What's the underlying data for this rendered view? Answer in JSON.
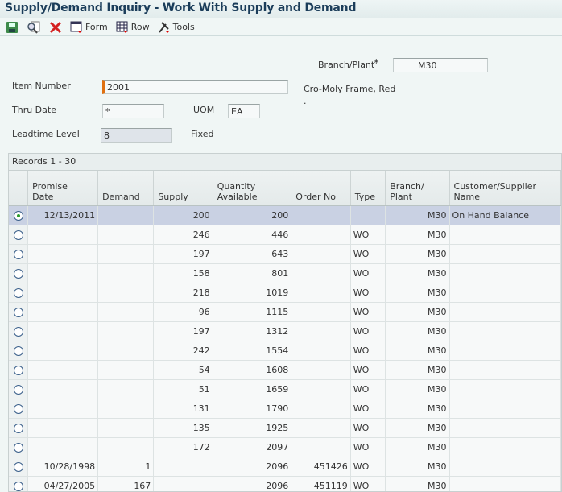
{
  "title": "Supply/Demand Inquiry - Work With Supply and Demand",
  "toolbar": {
    "save_icon": "floppy-disk-icon",
    "find_icon": "magnifier-icon",
    "close_icon": "red-x-icon",
    "form_label": "Form",
    "row_label": "Row",
    "tools_label": "Tools"
  },
  "form": {
    "branch_plant_label": "Branch/Plant",
    "required_mark": "*",
    "branch_plant_value": "M30",
    "item_number_label": "Item Number",
    "item_number_value": "2001",
    "item_description": "Cro-Moly Frame, Red",
    "item_description2": ".",
    "thru_date_label": "Thru Date",
    "thru_date_value": "*",
    "uom_label": "UOM",
    "uom_value": "EA",
    "leadtime_level_label": "Leadtime Level",
    "leadtime_level_value": "8",
    "leadtime_type": "Fixed"
  },
  "grid": {
    "records_label": "Records 1 - 30",
    "columns": [
      {
        "l1": "Promise",
        "l2": "Date"
      },
      {
        "l1": "",
        "l2": "Demand"
      },
      {
        "l1": "",
        "l2": "Supply"
      },
      {
        "l1": "Quantity",
        "l2": "Available"
      },
      {
        "l1": "",
        "l2": "Order No"
      },
      {
        "l1": "",
        "l2": "Type"
      },
      {
        "l1": "Branch/",
        "l2": "Plant"
      },
      {
        "l1": "",
        "l2": "Customer/Supplier Name"
      }
    ],
    "rows": [
      [
        "12/13/2011",
        "",
        "200",
        "200",
        "",
        "",
        "M30",
        "On Hand Balance"
      ],
      [
        "",
        "",
        "246",
        "446",
        "",
        "WO",
        "M30",
        ""
      ],
      [
        "",
        "",
        "197",
        "643",
        "",
        "WO",
        "M30",
        ""
      ],
      [
        "",
        "",
        "158",
        "801",
        "",
        "WO",
        "M30",
        ""
      ],
      [
        "",
        "",
        "218",
        "1019",
        "",
        "WO",
        "M30",
        ""
      ],
      [
        "",
        "",
        "96",
        "1115",
        "",
        "WO",
        "M30",
        ""
      ],
      [
        "",
        "",
        "197",
        "1312",
        "",
        "WO",
        "M30",
        ""
      ],
      [
        "",
        "",
        "242",
        "1554",
        "",
        "WO",
        "M30",
        ""
      ],
      [
        "",
        "",
        "54",
        "1608",
        "",
        "WO",
        "M30",
        ""
      ],
      [
        "",
        "",
        "51",
        "1659",
        "",
        "WO",
        "M30",
        ""
      ],
      [
        "",
        "",
        "131",
        "1790",
        "",
        "WO",
        "M30",
        ""
      ],
      [
        "",
        "",
        "135",
        "1925",
        "",
        "WO",
        "M30",
        ""
      ],
      [
        "",
        "",
        "172",
        "2097",
        "",
        "WO",
        "M30",
        ""
      ],
      [
        "10/28/1998",
        "1",
        "",
        "2096",
        "451426",
        "WO",
        "M30",
        ""
      ],
      [
        "04/27/2005",
        "167",
        "",
        "2096",
        "451119",
        "WO",
        "M30",
        ""
      ],
      [
        "",
        "",
        "",
        "",
        "",
        "",
        "",
        ""
      ]
    ],
    "selected_row": 0
  }
}
